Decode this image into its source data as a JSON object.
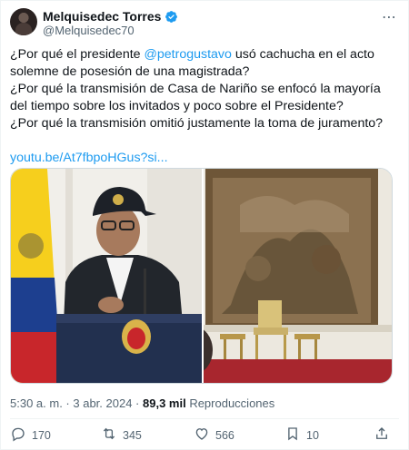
{
  "author": {
    "display_name": "Melquisedec Torres",
    "handle": "@Melquisedec70",
    "verified_icon": "verified-badge-icon",
    "verified_color": "#1d9bf0"
  },
  "tweet": {
    "line1_pre": "¿Por qué el presidente ",
    "mention": "@petrogustavo",
    "line1_post": " usó cachucha en el acto solemne de posesión de una magistrada?",
    "line2": "¿Por qué la transmisión de Casa de Nariño se enfocó la mayoría del tiempo  sobre los invitados y poco sobre el Presidente?",
    "line3": "¿Por qué la transmisión omitió justamente la toma de juramento?",
    "link": "youtu.be/At7fbpoHGus?si..."
  },
  "meta": {
    "time": "5:30 a. m.",
    "separator": " · ",
    "date": "3 abr. 2024",
    "views_count": "89,3 mil",
    "views_label": " Reproducciones"
  },
  "actions": {
    "replies": "170",
    "retweets": "345",
    "likes": "566",
    "bookmarks": "10"
  },
  "colors": {
    "accent": "#1d9bf0",
    "text": "#0f1419",
    "secondary": "#536471"
  }
}
